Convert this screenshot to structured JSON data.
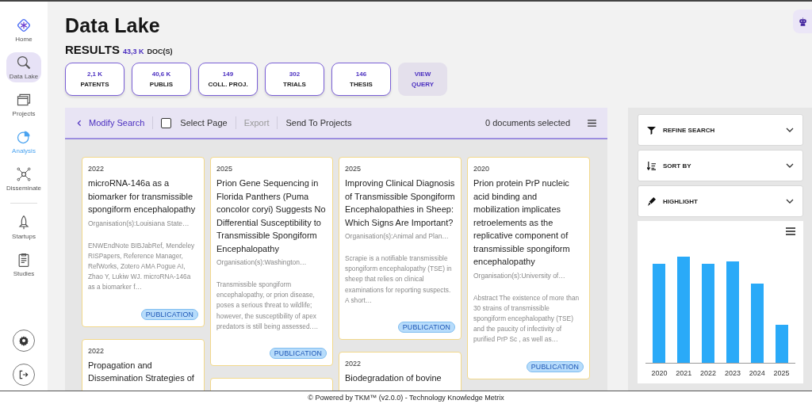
{
  "sidebar": {
    "nav": [
      {
        "label": "Home",
        "kind": "home",
        "selected": false,
        "highlighted": false
      },
      {
        "label": "Data Lake",
        "kind": "search",
        "selected": true,
        "highlighted": false
      },
      {
        "label": "Projects",
        "kind": "folders",
        "selected": false,
        "highlighted": false
      },
      {
        "label": "Analysis",
        "kind": "pie",
        "selected": false,
        "highlighted": true
      },
      {
        "label": "Disseminate",
        "kind": "network",
        "selected": false,
        "highlighted": false
      },
      {
        "label": "Startups",
        "kind": "rocket",
        "selected": false,
        "highlighted": false
      },
      {
        "label": "Studies",
        "kind": "clipboard",
        "selected": false,
        "highlighted": false
      }
    ]
  },
  "page": {
    "title": "Data Lake",
    "results_label": "RESULTS",
    "results_count": "43,3 K",
    "results_unit": "DOC(S)"
  },
  "stats": [
    {
      "kind": "count",
      "value": "2,1 K",
      "label": "PATENTS"
    },
    {
      "kind": "count",
      "value": "40,6 K",
      "label": "PUBLIS"
    },
    {
      "kind": "count",
      "value": "149",
      "label": "COLL. PROJ."
    },
    {
      "kind": "count",
      "value": "302",
      "label": "TRIALS"
    },
    {
      "kind": "count",
      "value": "146",
      "label": "THESIS"
    },
    {
      "kind": "action",
      "value": "VIEW",
      "label": "QUERY"
    }
  ],
  "toolbar": {
    "back": "Modify Search",
    "select_page": {
      "label": "Select Page",
      "checked": false
    },
    "actions": [
      {
        "label": "Export",
        "disabled": true
      },
      {
        "label": "Send To Projects",
        "disabled": false
      }
    ],
    "selection": "0 documents selected"
  },
  "columns": [
    [
      {
        "year": "2022",
        "title": "microRNA-146a as a biomarker for transmissible spongiform encephalopathy",
        "org": "Organisation(s):Louisiana State…",
        "abstract": "ENWEndNote BIBJabRef, Mendeley RISPapers, Reference Manager, RefWorks, Zotero AMA Pogue AI, Zhao Y, Lukiw WJ. microRNA-146a as a biomarker f…",
        "tag": "PUBLICATION"
      },
      {
        "year": "2022",
        "title": "Propagation and Dissemination Strategies of"
      }
    ],
    [
      {
        "year": "2025",
        "title": "Prion Gene Sequencing in Florida Panthers (Puma concolor coryi) Suggests No Differential Susceptibility to Transmissible Spongiform Encephalopathy",
        "org": "Organisation(s):Washington…",
        "abstract": "Transmissible spongiform encephalopathy, or prion disease, poses a serious threat to wildlife; however, the susceptibility of apex predators is still being assessed.…",
        "tag": "PUBLICATION"
      },
      {}
    ],
    [
      {
        "year": "2025",
        "title": "Improving Clinical Diagnosis of Transmissible Spongiform Encephalopathies in Sheep: Which Signs Are Important?",
        "org": "Organisation(s):Animal and Plan…",
        "abstract": "Scrapie is a notifiable transmissible spongiform encephalopathy (TSE) in sheep that relies on clinical examinations for reporting suspects. A short…",
        "tag": "PUBLICATION"
      },
      {
        "year": "2022",
        "title": "Biodegradation of bovine"
      }
    ],
    [
      {
        "year": "2020",
        "title": "Prion protein PrP nucleic acid binding and mobilization implicates retroelements as the replicative component of transmissible spongiform encephalopathy",
        "org": "Organisation(s):University of…",
        "abstract": "Abstract The existence of more than 30 strains of transmissible spongiform encephalopathy (TSE) and the paucity of infectivity of purified PrP Sc , as well as…",
        "tag": "PUBLICATION"
      }
    ]
  ],
  "filters": [
    {
      "kind": "funnel",
      "label": "REFINE SEARCH",
      "expanded": false
    },
    {
      "kind": "sort",
      "label": "SORT BY",
      "expanded": false
    },
    {
      "kind": "pen",
      "label": "HIGHLIGHT",
      "expanded": false
    }
  ],
  "year_chart": {
    "years": [
      "2020",
      "2021",
      "2022",
      "2023",
      "2024",
      "2025"
    ]
  },
  "footer": "© Powered by TKM™ (v2.0.0) - Technology Knowledge Metrix"
}
